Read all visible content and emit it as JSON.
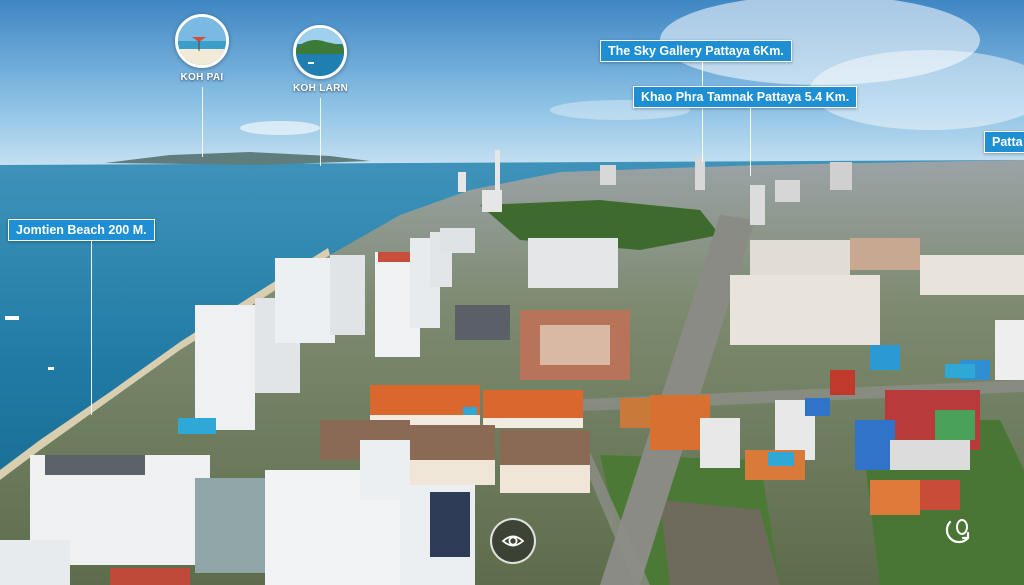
{
  "hotspots": {
    "koh_pai": {
      "label": "KOH PAI"
    },
    "koh_larn": {
      "label": "KOH LARN"
    }
  },
  "tags": {
    "sky_gallery": "The Sky Gallery Pattaya 6Km.",
    "khao_phra": "Khao Phra Tamnak Pattaya 5.4 Km.",
    "jomtien": "Jomtien Beach 200 M.",
    "pattaya_cut": "Patta"
  },
  "controls": {
    "eye_icon": "eye-icon",
    "gyro_icon": "gyroscope-icon"
  },
  "colors": {
    "tag_bg": "#1f8fd4",
    "sky": "#6aaedc",
    "sea": "#1b6f97"
  }
}
